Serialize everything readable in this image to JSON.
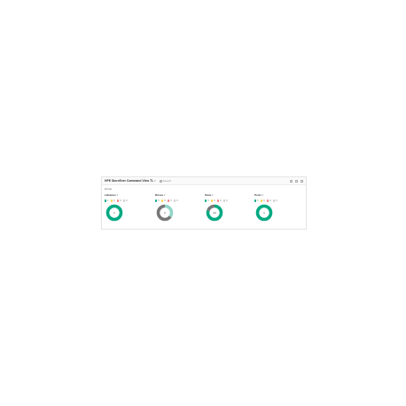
{
  "header": {
    "title": "HPE StoreEver Command View TL",
    "search_label": "Search"
  },
  "breadcrumb": "Home",
  "colors": {
    "ok": "#01a982",
    "warning": "#ffd144",
    "critical": "#ff7a7a",
    "unknown": "#cccccc",
    "disabled": "#777777",
    "info": "#91d6c8"
  },
  "panels": [
    {
      "title": "Libraries",
      "legend": [
        {
          "color": "#01a982",
          "value": "1"
        },
        {
          "color": "#ffd144",
          "value": "0"
        },
        {
          "color": "#ff7a7a",
          "value": "0"
        },
        {
          "color": "#cccccc",
          "value": "0"
        }
      ],
      "segments": [
        {
          "color": "#01a982",
          "fraction": 1.0
        }
      ],
      "center": "1"
    },
    {
      "title": "Drives",
      "legend": [
        {
          "color": "#01a982",
          "value": "0"
        },
        {
          "color": "#ffd144",
          "value": "0"
        },
        {
          "color": "#ff7a7a",
          "value": "0"
        },
        {
          "color": "#cccccc",
          "value": "0"
        }
      ],
      "segments": [
        {
          "color": "#91d6c8",
          "fraction": 0.35
        },
        {
          "color": "#777777",
          "fraction": 0.65
        }
      ],
      "center": "2"
    },
    {
      "title": "Slots",
      "legend": [
        {
          "color": "#01a982",
          "value": "0"
        },
        {
          "color": "#ffd144",
          "value": "0"
        },
        {
          "color": "#ff7a7a",
          "value": "0"
        },
        {
          "color": "#cccccc",
          "value": "0"
        }
      ],
      "segments": [
        {
          "color": "#01a982",
          "fraction": 0.8
        },
        {
          "color": "#777777",
          "fraction": 0.2
        }
      ],
      "center": "24"
    },
    {
      "title": "Ports",
      "legend": [
        {
          "color": "#01a982",
          "value": "1"
        },
        {
          "color": "#ffd144",
          "value": "0"
        },
        {
          "color": "#ff7a7a",
          "value": "0"
        },
        {
          "color": "#cccccc",
          "value": "0"
        }
      ],
      "segments": [
        {
          "color": "#01a982",
          "fraction": 1.0
        }
      ],
      "center": "1"
    }
  ]
}
